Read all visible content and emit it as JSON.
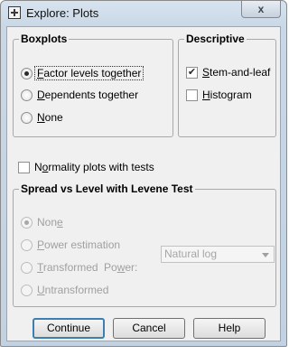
{
  "window": {
    "title": "Explore: Plots",
    "close_glyph": "x"
  },
  "boxplots": {
    "legend": "Boxplots",
    "options": [
      {
        "pre": "",
        "key": "F",
        "post": "actor levels together",
        "checked": true
      },
      {
        "pre": "",
        "key": "D",
        "post": "ependents together",
        "checked": false
      },
      {
        "pre": "",
        "key": "N",
        "post": "one",
        "checked": false
      }
    ]
  },
  "descriptive": {
    "legend": "Descriptive",
    "stem_leaf": {
      "pre": "",
      "key": "S",
      "post": "tem-and-leaf",
      "checked": true
    },
    "histogram": {
      "pre": "",
      "key": "H",
      "post": "istogram",
      "checked": false
    }
  },
  "normality": {
    "pre": "N",
    "key": "o",
    "post": "rmality plots with tests",
    "checked": false
  },
  "spread": {
    "legend": "Spread vs Level with Levene Test",
    "none": {
      "pre": "Non",
      "key": "e",
      "post": "",
      "checked": true
    },
    "power_estimation": {
      "pre": "",
      "key": "P",
      "post": "ower estimation",
      "checked": false
    },
    "transformed": {
      "pre": "",
      "key": "T",
      "post": "ransformed",
      "checked": false
    },
    "power_label": {
      "pre": "Po",
      "key": "w",
      "post": "er:"
    },
    "power_select": "Natural log",
    "untransformed": {
      "pre": "",
      "key": "U",
      "post": "ntransformed",
      "checked": false
    }
  },
  "buttons": {
    "continue": "Continue",
    "cancel": "Cancel",
    "help": "Help"
  },
  "check_glyph": "✔"
}
